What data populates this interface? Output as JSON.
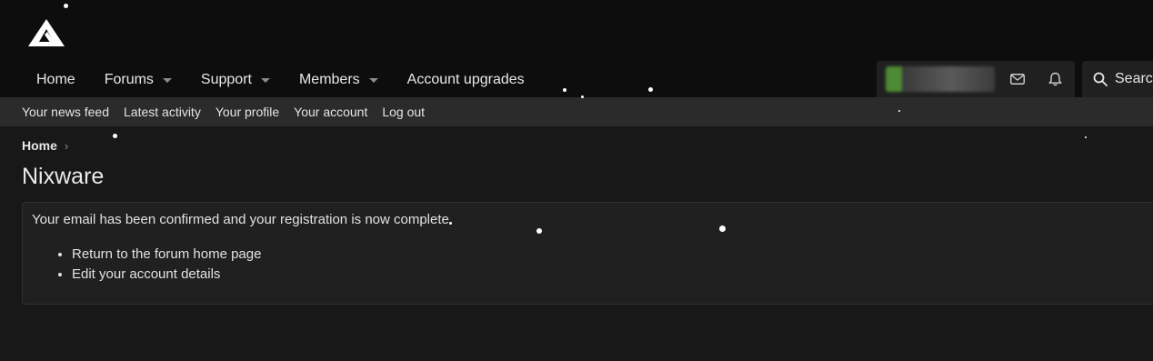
{
  "header": {
    "logo_name": "site-logo",
    "nav": [
      {
        "label": "Home",
        "has_menu": false
      },
      {
        "label": "Forums",
        "has_menu": true
      },
      {
        "label": "Support",
        "has_menu": true
      },
      {
        "label": "Members",
        "has_menu": true
      },
      {
        "label": "Account upgrades",
        "has_menu": false
      }
    ],
    "search_label": "Search"
  },
  "subnav": {
    "items": [
      "Your news feed",
      "Latest activity",
      "Your profile",
      "Your account",
      "Log out"
    ]
  },
  "breadcrumb": {
    "home": "Home",
    "separator": "›"
  },
  "page": {
    "title": "Nixware",
    "message": "Your email has been confirmed and your registration is now complete.",
    "links": [
      "Return to the forum home page",
      "Edit your account details"
    ]
  },
  "colors": {
    "header_bg": "#0d0d0d",
    "subnav_bg": "#2b2b2b",
    "page_bg": "#181818",
    "block_bg": "#202020",
    "avatar_accent": "#4e8a34"
  },
  "icons": [
    "mail-icon",
    "bell-icon",
    "search-icon"
  ]
}
